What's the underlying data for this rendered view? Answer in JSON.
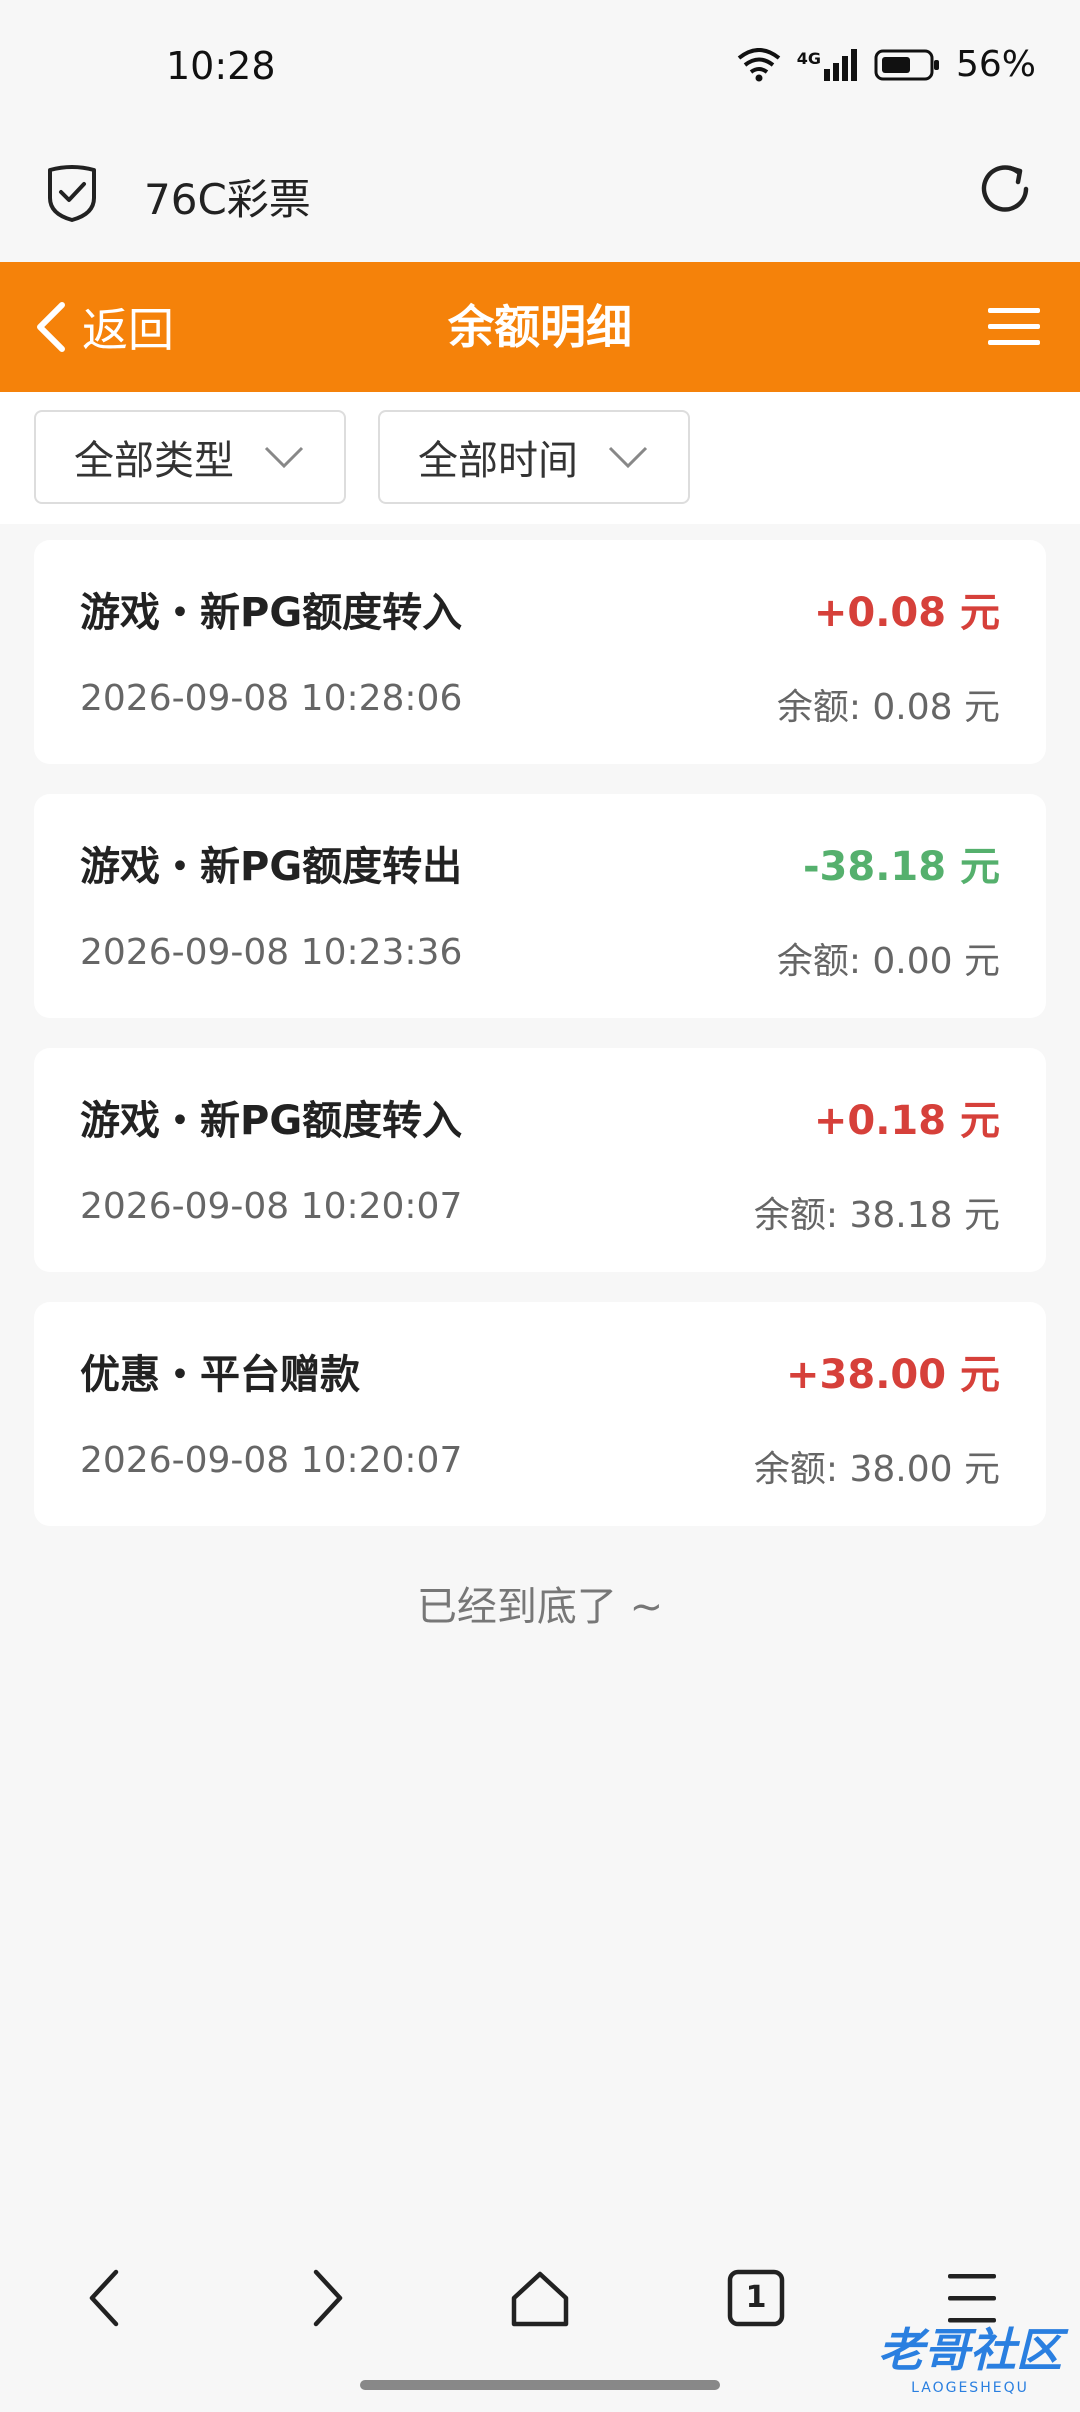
{
  "status_bar": {
    "time": "10:28",
    "network": "4G",
    "battery": "56%"
  },
  "browser": {
    "title": "76C彩票"
  },
  "header": {
    "back_label": "返回",
    "title": "余额明细"
  },
  "filters": {
    "type": "全部类型",
    "time": "全部时间"
  },
  "records": [
    {
      "title": "游戏・新PG额度转入",
      "amount": "+0.08 元",
      "time": "2026-09-08 10:28:06",
      "balance": "余额: 0.08 元"
    },
    {
      "title": "游戏・新PG额度转出",
      "amount": "-38.18 元",
      "time": "2026-09-08 10:23:36",
      "balance": "余额: 0.00 元"
    },
    {
      "title": "游戏・新PG额度转入",
      "amount": "+0.18 元",
      "time": "2026-09-08 10:20:07",
      "balance": "余额: 38.18 元"
    },
    {
      "title": "优惠・平台赠款",
      "amount": "+38.00 元",
      "time": "2026-09-08 10:20:07",
      "balance": "余额: 38.00 元"
    }
  ],
  "end_text": "已经到底了 ~",
  "nav": {
    "tabs_count": "1"
  },
  "watermark": {
    "main": "老哥社区",
    "sub": "LAOGESHEQU"
  },
  "colors": {
    "accent": "#f5820a",
    "positive": "#d6403a",
    "negative": "#55b06d"
  }
}
